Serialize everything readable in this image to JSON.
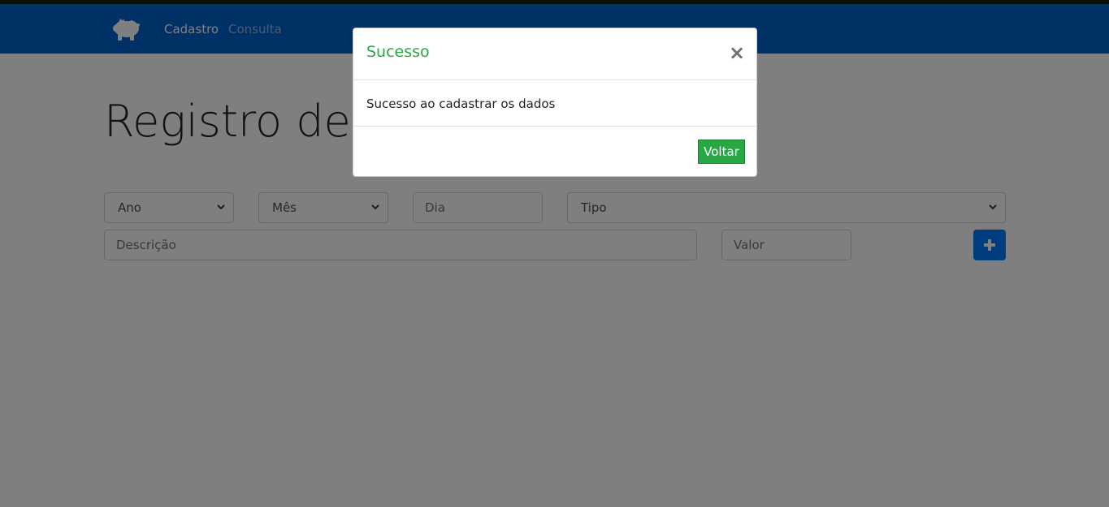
{
  "navbar": {
    "brand_icon": "piggy-bank-icon",
    "links": [
      {
        "label": "Cadastro",
        "active": true
      },
      {
        "label": "Consulta",
        "active": false
      }
    ],
    "background": "#0062cc"
  },
  "main": {
    "title": "Registro de n",
    "form": {
      "ano": {
        "value": "Ano"
      },
      "mes": {
        "value": "Mês"
      },
      "dia": {
        "placeholder": "Dia"
      },
      "tipo": {
        "value": "Tipo"
      },
      "descricao": {
        "placeholder": "Descrição"
      },
      "valor": {
        "placeholder": "Valor"
      },
      "add_icon": "plus-icon"
    }
  },
  "modal": {
    "title": "Sucesso",
    "title_color": "#28a745",
    "close_label": "×",
    "body": "Sucesso ao cadastrar os dados",
    "button_label": "Voltar",
    "button_color": "#28a745"
  }
}
